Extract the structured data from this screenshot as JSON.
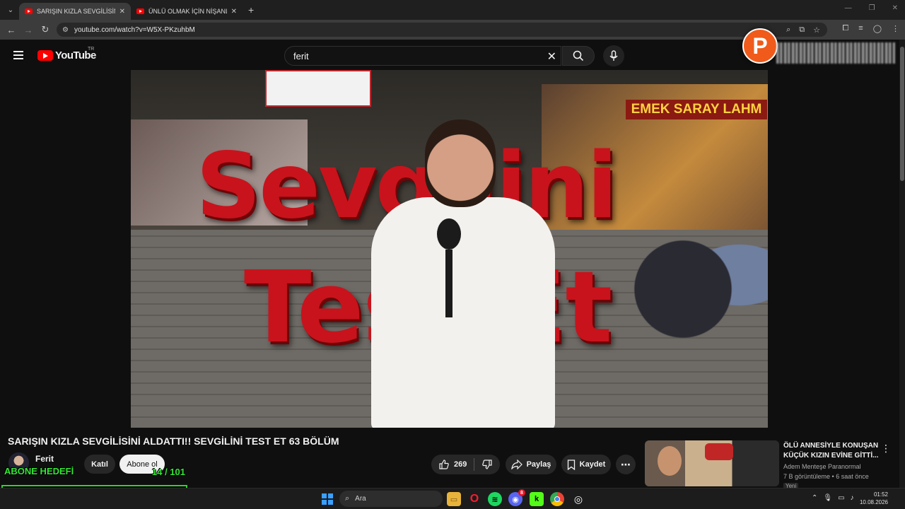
{
  "browser": {
    "tabs": [
      {
        "title": "SARIŞIN KIZLA SEVGİLİSİNİ ALDATTI",
        "active": true
      },
      {
        "title": "ÜNLÜ OLMAK İÇİN NİŞANLISINI",
        "active": false
      }
    ],
    "url": "youtube.com/watch?v=W5X-PKzuhbM"
  },
  "header": {
    "logo_text": "YouTube",
    "country_code": "TR",
    "search_value": "ferit",
    "overlay_logo_letter": "P"
  },
  "video": {
    "overlay_word_1": "Sevgilini",
    "overlay_word_2": "Test Et",
    "sign_text": "EMEK SARAY LAHM",
    "title": "SARIŞIN KIZLA SEVGİLİSİNİ ALDATTI!! SEVGİLİNİ TEST ET 63 BÖLÜM"
  },
  "channel": {
    "name": "Ferit",
    "join_label": "Katıl",
    "subscribe_label": "Abone ol"
  },
  "overlay_goal": {
    "label": "ABONE HEDEFİ",
    "count_text": "14 / 101",
    "progress": 0.14,
    "color": "#34e834"
  },
  "actions": {
    "like_count": "269",
    "share_label": "Paylaş",
    "save_label": "Kaydet"
  },
  "recommendation": {
    "title": "ÖLÜ ANNESİYLE KONUŞAN KÜÇÜK KIZIN EVİNE GİTTİ...",
    "channel": "Adem Menteşe Paranormal",
    "meta": "7 B görüntüleme • 6 saat önce",
    "badge": "Yeni"
  },
  "taskbar": {
    "search_placeholder": "Ara",
    "time": "01:52",
    "date": "10.08.2026",
    "discord_badge": "8"
  }
}
